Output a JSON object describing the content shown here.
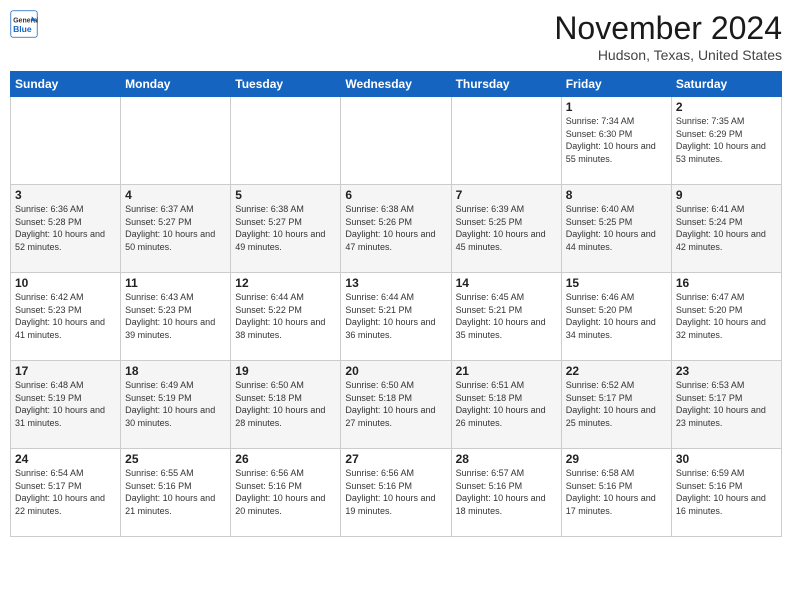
{
  "header": {
    "logo_line1": "General",
    "logo_line2": "Blue",
    "month": "November 2024",
    "location": "Hudson, Texas, United States"
  },
  "days_of_week": [
    "Sunday",
    "Monday",
    "Tuesday",
    "Wednesday",
    "Thursday",
    "Friday",
    "Saturday"
  ],
  "weeks": [
    [
      {
        "day": "",
        "data": ""
      },
      {
        "day": "",
        "data": ""
      },
      {
        "day": "",
        "data": ""
      },
      {
        "day": "",
        "data": ""
      },
      {
        "day": "",
        "data": ""
      },
      {
        "day": "1",
        "data": "Sunrise: 7:34 AM\nSunset: 6:30 PM\nDaylight: 10 hours and 55 minutes."
      },
      {
        "day": "2",
        "data": "Sunrise: 7:35 AM\nSunset: 6:29 PM\nDaylight: 10 hours and 53 minutes."
      }
    ],
    [
      {
        "day": "3",
        "data": "Sunrise: 6:36 AM\nSunset: 5:28 PM\nDaylight: 10 hours and 52 minutes."
      },
      {
        "day": "4",
        "data": "Sunrise: 6:37 AM\nSunset: 5:27 PM\nDaylight: 10 hours and 50 minutes."
      },
      {
        "day": "5",
        "data": "Sunrise: 6:38 AM\nSunset: 5:27 PM\nDaylight: 10 hours and 49 minutes."
      },
      {
        "day": "6",
        "data": "Sunrise: 6:38 AM\nSunset: 5:26 PM\nDaylight: 10 hours and 47 minutes."
      },
      {
        "day": "7",
        "data": "Sunrise: 6:39 AM\nSunset: 5:25 PM\nDaylight: 10 hours and 45 minutes."
      },
      {
        "day": "8",
        "data": "Sunrise: 6:40 AM\nSunset: 5:25 PM\nDaylight: 10 hours and 44 minutes."
      },
      {
        "day": "9",
        "data": "Sunrise: 6:41 AM\nSunset: 5:24 PM\nDaylight: 10 hours and 42 minutes."
      }
    ],
    [
      {
        "day": "10",
        "data": "Sunrise: 6:42 AM\nSunset: 5:23 PM\nDaylight: 10 hours and 41 minutes."
      },
      {
        "day": "11",
        "data": "Sunrise: 6:43 AM\nSunset: 5:23 PM\nDaylight: 10 hours and 39 minutes."
      },
      {
        "day": "12",
        "data": "Sunrise: 6:44 AM\nSunset: 5:22 PM\nDaylight: 10 hours and 38 minutes."
      },
      {
        "day": "13",
        "data": "Sunrise: 6:44 AM\nSunset: 5:21 PM\nDaylight: 10 hours and 36 minutes."
      },
      {
        "day": "14",
        "data": "Sunrise: 6:45 AM\nSunset: 5:21 PM\nDaylight: 10 hours and 35 minutes."
      },
      {
        "day": "15",
        "data": "Sunrise: 6:46 AM\nSunset: 5:20 PM\nDaylight: 10 hours and 34 minutes."
      },
      {
        "day": "16",
        "data": "Sunrise: 6:47 AM\nSunset: 5:20 PM\nDaylight: 10 hours and 32 minutes."
      }
    ],
    [
      {
        "day": "17",
        "data": "Sunrise: 6:48 AM\nSunset: 5:19 PM\nDaylight: 10 hours and 31 minutes."
      },
      {
        "day": "18",
        "data": "Sunrise: 6:49 AM\nSunset: 5:19 PM\nDaylight: 10 hours and 30 minutes."
      },
      {
        "day": "19",
        "data": "Sunrise: 6:50 AM\nSunset: 5:18 PM\nDaylight: 10 hours and 28 minutes."
      },
      {
        "day": "20",
        "data": "Sunrise: 6:50 AM\nSunset: 5:18 PM\nDaylight: 10 hours and 27 minutes."
      },
      {
        "day": "21",
        "data": "Sunrise: 6:51 AM\nSunset: 5:18 PM\nDaylight: 10 hours and 26 minutes."
      },
      {
        "day": "22",
        "data": "Sunrise: 6:52 AM\nSunset: 5:17 PM\nDaylight: 10 hours and 25 minutes."
      },
      {
        "day": "23",
        "data": "Sunrise: 6:53 AM\nSunset: 5:17 PM\nDaylight: 10 hours and 23 minutes."
      }
    ],
    [
      {
        "day": "24",
        "data": "Sunrise: 6:54 AM\nSunset: 5:17 PM\nDaylight: 10 hours and 22 minutes."
      },
      {
        "day": "25",
        "data": "Sunrise: 6:55 AM\nSunset: 5:16 PM\nDaylight: 10 hours and 21 minutes."
      },
      {
        "day": "26",
        "data": "Sunrise: 6:56 AM\nSunset: 5:16 PM\nDaylight: 10 hours and 20 minutes."
      },
      {
        "day": "27",
        "data": "Sunrise: 6:56 AM\nSunset: 5:16 PM\nDaylight: 10 hours and 19 minutes."
      },
      {
        "day": "28",
        "data": "Sunrise: 6:57 AM\nSunset: 5:16 PM\nDaylight: 10 hours and 18 minutes."
      },
      {
        "day": "29",
        "data": "Sunrise: 6:58 AM\nSunset: 5:16 PM\nDaylight: 10 hours and 17 minutes."
      },
      {
        "day": "30",
        "data": "Sunrise: 6:59 AM\nSunset: 5:16 PM\nDaylight: 10 hours and 16 minutes."
      }
    ]
  ]
}
